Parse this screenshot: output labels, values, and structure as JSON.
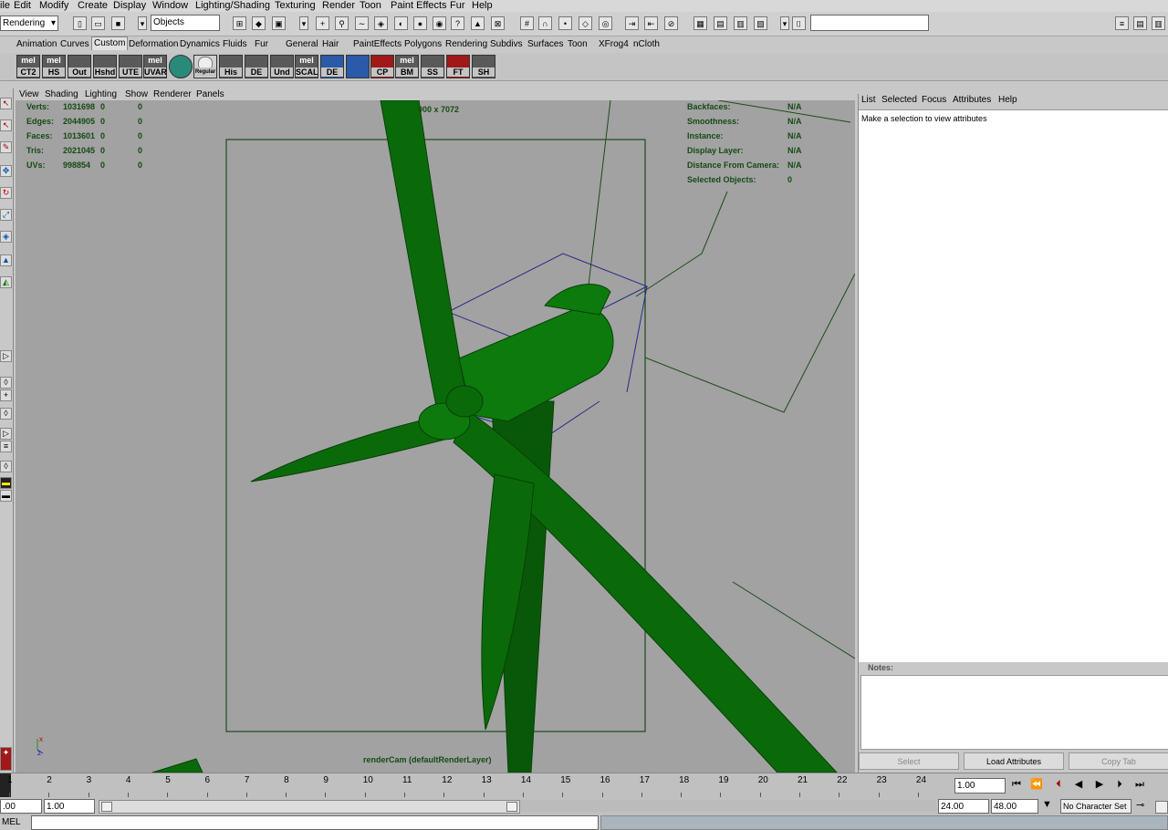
{
  "menubar": [
    "ile",
    "Edit",
    "Modify",
    "Create",
    "Display",
    "Window",
    "Lighting/Shading",
    "Texturing",
    "Render",
    "Toon",
    "Paint Effects",
    "Fur",
    "Help"
  ],
  "statusline": {
    "menuset": "Rendering",
    "selection_mode": "Objects"
  },
  "shelf_tabs": [
    "Animation",
    "Curves",
    "Custom",
    "Deformation",
    "Dynamics",
    "Fluids",
    "Fur",
    "General",
    "Hair",
    "PaintEffects",
    "Polygons",
    "Rendering",
    "Subdivs",
    "Surfaces",
    "Toon",
    "XFrog4",
    "nCloth"
  ],
  "shelf_active": "Custom",
  "shelf_buttons": [
    {
      "top": "mel",
      "label": "CT2"
    },
    {
      "top": "mel",
      "label": "HS"
    },
    {
      "top": "",
      "label": "Out"
    },
    {
      "top": "",
      "label": "Hshd"
    },
    {
      "top": "",
      "label": "UTE"
    },
    {
      "top": "mel",
      "label": "UVAR"
    },
    {
      "top": "",
      "label": ""
    },
    {
      "top": "",
      "label": "Regular"
    },
    {
      "top": "",
      "label": "His"
    },
    {
      "top": "",
      "label": "DE"
    },
    {
      "top": "",
      "label": "Und"
    },
    {
      "top": "mel",
      "label": "SCAL"
    },
    {
      "top": "",
      "label": "DE"
    },
    {
      "top": "",
      "label": ""
    },
    {
      "top": "",
      "label": "CP"
    },
    {
      "top": "mel",
      "label": "BM"
    },
    {
      "top": "",
      "label": "SS"
    },
    {
      "top": "",
      "label": "FT"
    },
    {
      "top": "",
      "label": "SH"
    }
  ],
  "viewport_menu": [
    "View",
    "Shading",
    "Lighting",
    "Show",
    "Renderer",
    "Panels"
  ],
  "hud_left": [
    {
      "label": "Verts:",
      "v1": "1031698",
      "v2": "0",
      "v3": "0"
    },
    {
      "label": "Edges:",
      "v1": "2044905",
      "v2": "0",
      "v3": "0"
    },
    {
      "label": "Faces:",
      "v1": "1013601",
      "v2": "0",
      "v3": "0"
    },
    {
      "label": "Tris:",
      "v1": "2021045",
      "v2": "0",
      "v3": "0"
    },
    {
      "label": "UVs:",
      "v1": "998854",
      "v2": "0",
      "v3": "0"
    }
  ],
  "hud_right": [
    {
      "label": "Backfaces:",
      "value": "N/A"
    },
    {
      "label": "Smoothness:",
      "value": "N/A"
    },
    {
      "label": "Instance:",
      "value": "N/A"
    },
    {
      "label": "Display Layer:",
      "value": "N/A"
    },
    {
      "label": "Distance From Camera:",
      "value": "N/A"
    },
    {
      "label": "Selected Objects:",
      "value": "0"
    }
  ],
  "resolution_gate": "000 x 7072",
  "camera_label": "renderCam (defaultRenderLayer)",
  "attr_menu": [
    "List",
    "Selected",
    "Focus",
    "Attributes",
    "Help"
  ],
  "attr_message": "Make a selection to view attributes",
  "notes_label": "Notes:",
  "attr_buttons": [
    "Select",
    "Load Attributes",
    "Copy Tab"
  ],
  "timeline_ticks": [
    "1",
    "2",
    "3",
    "4",
    "5",
    "6",
    "7",
    "8",
    "9",
    "10",
    "11",
    "12",
    "13",
    "14",
    "15",
    "16",
    "17",
    "18",
    "19",
    "20",
    "21",
    "22",
    "23",
    "24"
  ],
  "current_time": "1.00",
  "range": {
    "start_outer": ".00",
    "start": "1.00",
    "end": "24.00",
    "end_outer": "48.00"
  },
  "character_set": "No Character Set",
  "cmd_label": "MEL",
  "colors": {
    "turbine": "#0a6a0a",
    "viewport": "#a2a2a2",
    "hud": "#154a15",
    "gate": "#1d4a1d",
    "bbox": "#2a2a8a"
  }
}
